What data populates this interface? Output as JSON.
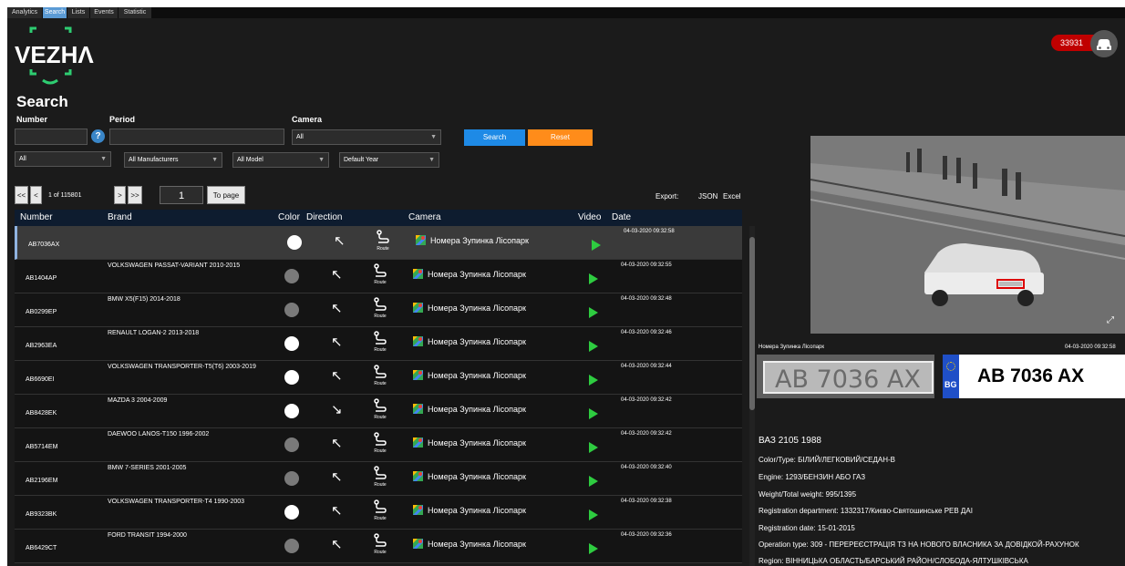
{
  "tabs": [
    "Analytics",
    "Search",
    "Lists",
    "Events",
    "Statistic"
  ],
  "active_tab": "Search",
  "logo": {
    "text": "VEZHΛ",
    "color": "#2ecc71"
  },
  "header_badge": {
    "count": "33931",
    "icon": "car-icon"
  },
  "page_title": "Search",
  "filters": {
    "number_label": "Number",
    "period_label": "Period",
    "camera_label": "Camera",
    "camera_value": "All",
    "type_value": "All",
    "manufacturer_value": "All Manufacturers",
    "model_value": "All Model",
    "year_value": "Default Year",
    "search_label": "Search",
    "reset_label": "Reset"
  },
  "pagination": {
    "first": "<<",
    "prev": "<",
    "info": "1 of 115801",
    "next": ">",
    "last": ">>",
    "page": "1",
    "to_page": "To page"
  },
  "export": {
    "label": "Export:",
    "json": "JSON",
    "excel": "Excel"
  },
  "table": {
    "headers": [
      "Number",
      "Brand",
      "Color",
      "Direction",
      "Camera",
      "Video",
      "Date"
    ],
    "rows": [
      {
        "number": "AB7036AX",
        "brand": "",
        "color": "#ffffff",
        "dir": "↖",
        "camera": "Номера Зупинка Лісопарк",
        "date": "04-03-2020 09:32:58",
        "selected": true
      },
      {
        "number": "AB1404AP",
        "brand": "VOLKSWAGEN PASSAT-VARIANT 2010-2015",
        "color": "#7a7a7a",
        "dir": "↖",
        "camera": "Номера Зупинка Лісопарк",
        "date": "04-03-2020 09:32:55"
      },
      {
        "number": "AB0299EP",
        "brand": "BMW X5(F15) 2014-2018",
        "color": "#7a7a7a",
        "dir": "↖",
        "camera": "Номера Зупинка Лісопарк",
        "date": "04-03-2020 09:32:48"
      },
      {
        "number": "AB2963EA",
        "brand": "RENAULT LOGAN-2 2013-2018",
        "color": "#ffffff",
        "dir": "↖",
        "camera": "Номера Зупинка Лісопарк",
        "date": "04-03-2020 09:32:46"
      },
      {
        "number": "AB6690EI",
        "brand": "VOLKSWAGEN TRANSPORTER-T5(T6) 2003-2019",
        "color": "#ffffff",
        "dir": "↖",
        "camera": "Номера Зупинка Лісопарк",
        "date": "04-03-2020 09:32:44"
      },
      {
        "number": "AB8428EK",
        "brand": "MAZDA 3 2004-2009",
        "color": "#ffffff",
        "dir": "↘",
        "camera": "Номера Зупинка Лісопарк",
        "date": "04-03-2020 09:32:42"
      },
      {
        "number": "AB5714EM",
        "brand": "DAEWOO LANOS-T150 1996-2002",
        "color": "#7a7a7a",
        "dir": "↖",
        "camera": "Номера Зупинка Лісопарк",
        "date": "04-03-2020 09:32:42"
      },
      {
        "number": "AB2196EM",
        "brand": "BMW 7-SERIES 2001-2005",
        "color": "#7a7a7a",
        "dir": "↖",
        "camera": "Номера Зупинка Лісопарк",
        "date": "04-03-2020 09:32:40"
      },
      {
        "number": "AB9323BK",
        "brand": "VOLKSWAGEN TRANSPORTER-T4 1990-2003",
        "color": "#ffffff",
        "dir": "↖",
        "camera": "Номера Зупинка Лісопарк",
        "date": "04-03-2020 09:32:38"
      },
      {
        "number": "AB6429CT",
        "brand": "FORD TRANSIT 1994-2000",
        "color": "#7a7a7a",
        "dir": "↖",
        "camera": "Номера Зупинка Лісопарк",
        "date": "04-03-2020 09:32:36"
      }
    ],
    "route_label": "Route"
  },
  "detail": {
    "camera": "Номера Зупинка Лісопарк",
    "date": "04-03-2020 09:32:58",
    "plate_text": "AB 7036 AX",
    "plate_crop_text": "AB 7036 AX",
    "plate_country": "BG",
    "vehicle": "ВАЗ 2105 1988",
    "color_type": "Color/Type: БІЛИЙ/ЛЕГКОВИЙ/СЕДАН-В",
    "engine": "Engine: 1293/БЕНЗИН АБО ГАЗ",
    "weight": "Weight/Total weight: 995/1395",
    "reg_dept": "Registration department: 1332317/Києво-Святошинське РЕВ ДАІ",
    "reg_date": "Registration date: 15-01-2015",
    "operation": "Operation type: 309 - ПЕРЕРЕЄСТРАЦІЯ ТЗ НА НОВОГО ВЛАСНИКА ЗА ДОВІДКОЙ-РАХУНОК",
    "region": "Region: ВІННИЦЬКА ОБЛАСТЬ/БАРСЬКИЙ РАЙОН/СЛОБОДА-ЯЛТУШКІВСЬКА"
  }
}
